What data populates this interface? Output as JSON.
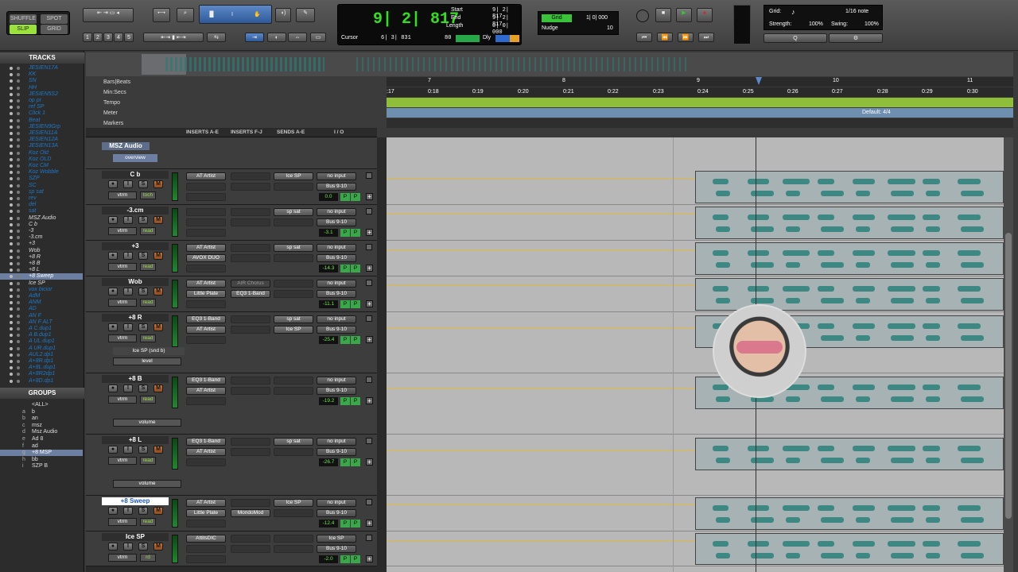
{
  "toolbar": {
    "modes": [
      "SHUFFLE",
      "SPOT",
      "SLIP",
      "GRID"
    ],
    "zoom_presets": [
      "1",
      "2",
      "3",
      "4",
      "5"
    ],
    "main_counter": "9| 2| 817",
    "start_label": "Start",
    "start_value": "9| 2| 817",
    "end_label": "End",
    "end_value": "9| 2| 817",
    "length_label": "Length",
    "length_value": "0| 0| 000",
    "cursor_label": "Cursor",
    "cursor_value": "6| 3| 831",
    "zoom_val": "80",
    "dly_label": "Dly",
    "grid_label": "Grid",
    "grid_value": "1| 0| 000",
    "nudge_label": "Nudge",
    "nudge_value": "10",
    "grid_note_label": "Grid:",
    "grid_note_value": "1/16 note",
    "strength_label": "Strength:",
    "strength_value": "100%",
    "swing_label": "Swing:",
    "swing_value": "100%"
  },
  "track_list": {
    "title": "TRACKS",
    "items": [
      {
        "name": "JESIEN17A",
        "style": "it"
      },
      {
        "name": "KK",
        "style": "it"
      },
      {
        "name": "SN",
        "style": "it"
      },
      {
        "name": "HH",
        "style": "it"
      },
      {
        "name": "JESIEN5S2",
        "style": "it"
      },
      {
        "name": "op pr",
        "style": "it"
      },
      {
        "name": "ref SP",
        "style": "it"
      },
      {
        "name": "Click 1",
        "style": "it"
      },
      {
        "name": "Beat",
        "style": "it"
      },
      {
        "name": "JESIEN9Grp",
        "style": "it"
      },
      {
        "name": "JESIEN11A",
        "style": "it"
      },
      {
        "name": "JESIEN12A",
        "style": "it"
      },
      {
        "name": "JESIEN13A",
        "style": "it"
      },
      {
        "name": "Koz Old",
        "style": "it"
      },
      {
        "name": "Koz OLD",
        "style": "it"
      },
      {
        "name": "Koz CM",
        "style": "it"
      },
      {
        "name": "Koz Wobble",
        "style": "it"
      },
      {
        "name": "SZP",
        "style": "it"
      },
      {
        "name": "SC",
        "style": "it"
      },
      {
        "name": "sp sat",
        "style": "it"
      },
      {
        "name": "rev",
        "style": "it"
      },
      {
        "name": "del",
        "style": "it"
      },
      {
        "name": "sat",
        "style": "it"
      },
      {
        "name": "MSZ Audio",
        "style": "blk"
      },
      {
        "name": "C b",
        "style": "blk"
      },
      {
        "name": "-3",
        "style": "blk"
      },
      {
        "name": "-3.cm",
        "style": "blk"
      },
      {
        "name": "+3",
        "style": "blk"
      },
      {
        "name": "Wob",
        "style": "blk"
      },
      {
        "name": "+8 R",
        "style": "blk"
      },
      {
        "name": "+8 B",
        "style": "blk"
      },
      {
        "name": "+8 L",
        "style": "blk"
      },
      {
        "name": "+8 Sweep",
        "style": "sel"
      },
      {
        "name": "Ice SP",
        "style": "blk"
      },
      {
        "name": "vox bicior",
        "style": "it"
      },
      {
        "name": "AdM",
        "style": "it"
      },
      {
        "name": "ANM",
        "style": "it"
      },
      {
        "name": "AD",
        "style": "it"
      },
      {
        "name": "AN F",
        "style": "it"
      },
      {
        "name": "AN F ALT",
        "style": "it"
      },
      {
        "name": "A C.dup1",
        "style": "it"
      },
      {
        "name": "A B.dup1",
        "style": "it"
      },
      {
        "name": "A UL.dup1",
        "style": "it"
      },
      {
        "name": "A UR.dup1",
        "style": "it"
      },
      {
        "name": "AUL2.dp1",
        "style": "it"
      },
      {
        "name": "A+8R.dp1",
        "style": "it"
      },
      {
        "name": "A+8L.dup1",
        "style": "it"
      },
      {
        "name": "A+8R2dp1",
        "style": "it"
      },
      {
        "name": "A+8D.dp1",
        "style": "it"
      }
    ]
  },
  "group_list": {
    "title": "GROUPS",
    "items": [
      {
        "key": "",
        "name": "<ALL>",
        "sel": false
      },
      {
        "key": "a",
        "name": "b",
        "sel": false
      },
      {
        "key": "b",
        "name": "an",
        "sel": false
      },
      {
        "key": "c",
        "name": "msz",
        "sel": false
      },
      {
        "key": "d",
        "name": "Msz Audio",
        "sel": false
      },
      {
        "key": "e",
        "name": "Ad 8",
        "sel": false
      },
      {
        "key": "f",
        "name": "ad",
        "sel": false
      },
      {
        "key": "g",
        "name": "+8 MSP",
        "sel": true
      },
      {
        "key": "h",
        "name": "bb",
        "sel": false
      },
      {
        "key": "i",
        "name": "SZP B",
        "sel": false
      }
    ]
  },
  "rulers": {
    "bars_label": "Bars|Beats",
    "min_label": "Min:Secs",
    "tempo_label": "Tempo",
    "meter_label": "Meter",
    "markers_label": "Markers",
    "meter_default": "Default: 4/4",
    "bars": [
      "7",
      "8",
      "9",
      "10",
      "11"
    ],
    "secs": [
      ":17",
      "0:18",
      "0:19",
      "0:20",
      "0:21",
      "0:22",
      "0:23",
      "0:24",
      "0:25",
      "0:26",
      "0:27",
      "0:28",
      "0:29",
      "0:30"
    ]
  },
  "mix_header": {
    "inserts_ae": "INSERTS A-E",
    "inserts_fj": "INSERTS F-J",
    "sends_ae": "SENDS A-E",
    "io": "I / O"
  },
  "folder": {
    "name": "MSZ Audio",
    "view": "overview"
  },
  "tracks": [
    {
      "name": "C b",
      "ins1": "AT Artist",
      "ins2": "",
      "fj": "",
      "send_a": "Ice SP",
      "send_b": "",
      "input": "no input",
      "output": "Bus 9-10",
      "volume": "0.0",
      "auto": "vtrm",
      "mode": "toch",
      "sub": null,
      "sel": false
    },
    {
      "name": "-3.cm",
      "ins1": "",
      "ins2": "",
      "fj": "",
      "send_a": "sp sat",
      "send_b": "",
      "input": "no input",
      "output": "Bus 9-10",
      "volume": "-3.1",
      "auto": "vtrm",
      "mode": "read",
      "sub": null,
      "sel": false
    },
    {
      "name": "+3",
      "ins1": "AT Artist",
      "ins2": "AVOX DUO",
      "fj": "",
      "send_a": "sp sat",
      "send_b": "",
      "input": "no input",
      "output": "Bus 9-10",
      "volume": "-14.3",
      "auto": "vtrm",
      "mode": "read",
      "sub": null,
      "sel": false
    },
    {
      "name": "Wob",
      "ins1": "AT Artist",
      "ins2": "Little Plate",
      "fj": "AIR Chorus",
      "fj2": "EQ3 1-Band",
      "send_a": "",
      "send_b": "",
      "input": "no input",
      "output": "Bus 9-10",
      "volume": "-11.1",
      "auto": "vtrm",
      "mode": "read",
      "sub": null,
      "sel": false
    },
    {
      "name": "+8 R",
      "ins1": "EQ3 1-Band",
      "ins2": "AT Artist",
      "fj": "",
      "send_a": "sp sat",
      "send_b": "Ice SP",
      "input": "no input",
      "output": "Bus 9-10",
      "volume": "-25.4",
      "auto": "vtrm",
      "mode": "read",
      "sub": [
        "Ice SP (snd b)",
        "level"
      ],
      "sel": false
    },
    {
      "name": "+8 B",
      "ins1": "EQ3 1-Band",
      "ins2": "AT Artist",
      "fj": "",
      "send_a": "",
      "send_b": "",
      "input": "no input",
      "output": "Bus 9-10",
      "volume": "-19.2",
      "auto": "vtrm",
      "mode": "read",
      "sub": [
        "",
        "volume"
      ],
      "sel": false
    },
    {
      "name": "+8 L",
      "ins1": "EQ3 1-Band",
      "ins2": "AT Artist",
      "fj": "",
      "send_a": "sp sat",
      "send_b": "",
      "input": "no input",
      "output": "Bus 9-10",
      "volume": "-26.7",
      "auto": "vtrm",
      "mode": "read",
      "sub": [
        "",
        "volume"
      ],
      "sel": false
    },
    {
      "name": "+8 Sweep",
      "ins1": "AT Artist",
      "ins2": "Little Plate",
      "fj": "",
      "fj2": "MondoMod",
      "send_a": "Ice SP",
      "send_b": "",
      "input": "no input",
      "output": "Bus 9-10",
      "volume": "-12.4",
      "auto": "vtrm",
      "mode": "read",
      "sub": null,
      "sel": true
    },
    {
      "name": "Ice SP",
      "ins1": "AttitsDIC",
      "ins2": "",
      "fj": "",
      "send_a": "",
      "send_b": "",
      "input": "Ice SP",
      "output": "Bus 9-10",
      "volume": "-2.0",
      "auto": "vtrm",
      "mode": "rd",
      "sub": null,
      "sel": false
    }
  ],
  "colors": {
    "accent_green": "#34e01e",
    "selected_blue": "#6d7fa0",
    "clip": "#a7b2b5",
    "wave": "#3e8884",
    "automation": "#e0b83a"
  }
}
